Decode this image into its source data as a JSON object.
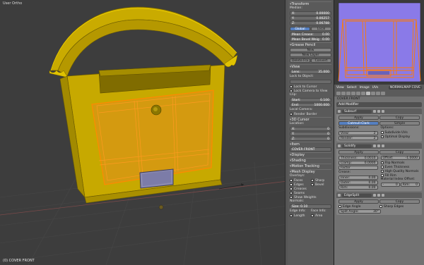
{
  "viewport": {
    "title": "User Ortho",
    "status": "(0) COVER FRONT"
  },
  "npanel": {
    "transform_header": "Transform",
    "median_label": "Median:",
    "x": {
      "label": "X:",
      "value": "0.00000"
    },
    "y": {
      "label": "Y:",
      "value": "0.00257"
    },
    "z": {
      "label": "Z:",
      "value": "0.06788"
    },
    "global": "Global",
    "local": "Local",
    "mean_crease": {
      "label": "Mean Crease:",
      "value": "0.00"
    },
    "mean_bevel": {
      "label": "Mean Bevel Weig",
      "value": "0.00"
    },
    "gpencil_header": "Grease Pencil",
    "new": "New",
    "new_layer": "New Layer",
    "delete_frame": "Delete Fra",
    "convert": "Convert",
    "view_header": "View",
    "lens": {
      "label": "Lens:",
      "value": "35.000"
    },
    "lock_to_object": "Lock to Object:",
    "lock_to_cursor": "Lock to Cursor",
    "lock_camera": "Lock Camera to View",
    "clip_label": "Clip:",
    "clip_start": {
      "label": "Start:",
      "value": "0.100"
    },
    "clip_end": {
      "label": "End:",
      "value": "1000.000"
    },
    "local_camera": "Local Camera:",
    "render_border": "Render Border",
    "cursor_header": "3D Cursor",
    "location_label": "Location:",
    "cx": {
      "label": "X:",
      "value": "0"
    },
    "cy": {
      "label": "Y:",
      "value": "0"
    },
    "cz": {
      "label": "Z:",
      "value": "0"
    },
    "item_header": "Item",
    "item_name": "COVER FRONT",
    "display_header": "Display",
    "shading_header": "Shading",
    "motion_tracking": "Motion Tracking",
    "mesh_display_header": "Mesh Display",
    "overlays_label": "Overlays:",
    "faces": "Faces",
    "sharp": "Sharp",
    "edges": "Edges",
    "bevel": "Bevel",
    "creases": "Creases",
    "seams": "Seams",
    "show_weights": "Show Weights",
    "normals_label": "Normals:",
    "size_label": "Size: 0.10",
    "edge_info": "Edge Info:",
    "face_info": "Face Info:",
    "length": "Length",
    "area": "Area"
  },
  "uv_header": {
    "items": [
      "View",
      "Select",
      "Image",
      "UVs"
    ],
    "uvmap": "NORMALMAP COVE"
  },
  "props": {
    "breadcrumb": "COVER FRONT",
    "add_modifier": "Add Modifier",
    "subsurf": {
      "name": "Subsurf",
      "apply": "Apply",
      "copy": "Copy",
      "catmull": "Catmull-Clark",
      "simple": "Simple",
      "subdivisions": "Subdivisions:",
      "options": "Options:",
      "view": {
        "label": "View:",
        "value": "2"
      },
      "render": {
        "label": "Render:",
        "value": "2"
      },
      "subdivide_uvs": "Subdivide UVs",
      "optimal_display": "Optimal Display"
    },
    "solidify": {
      "name": "Solidify",
      "apply": "Apply",
      "copy": "Copy",
      "thickness": {
        "label": "Thickness:",
        "value": "0.0010"
      },
      "offset": {
        "label": "Offset:",
        "value": "-1.0000"
      },
      "clamp": {
        "label": "Clamp:",
        "value": "0.0000"
      },
      "flip_normals": "Flip Normals",
      "even_thickness": "Even Thickness",
      "high_quality": "High Quality Normals",
      "fill_rim": "Fill Rim",
      "factor": "Factor",
      "crease_label": "Crease:",
      "material_offset": "Material Index Offset:",
      "inner": {
        "label": "Inner:",
        "value": "0.00"
      },
      "outer": {
        "label": "Outer:",
        "value": "0.00"
      },
      "rim": {
        "label": "Rim:",
        "value": "0.00"
      },
      "mat": {
        "label": "-",
        "value": "0"
      },
      "rim2": {
        "label": "Rim:",
        "value": "0"
      }
    },
    "edgesplit": {
      "name": "EdgeSplit",
      "apply": "Apply",
      "copy": "Copy",
      "edge_angle": "Edge Angle",
      "sharp_edges": "Sharp Edges",
      "split_angle": {
        "label": "Split Angle:",
        "value": "30°"
      }
    }
  },
  "colors": {
    "mailbox": "#d4b400",
    "mailbox_dark": "#8a7400",
    "selection": "#ff7a00",
    "uv_bg": "#8a7ae8"
  }
}
